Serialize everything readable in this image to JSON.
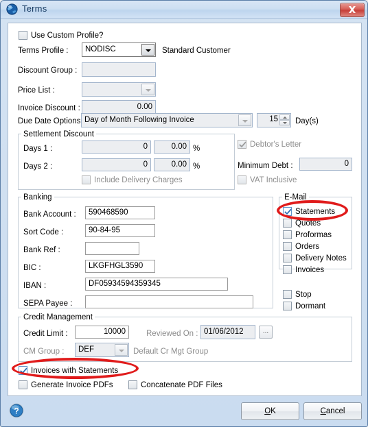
{
  "window": {
    "title": "Terms",
    "app_icon": "globe-icon",
    "close_label": "close-icon"
  },
  "form": {
    "use_custom_profile": {
      "label": "Use Custom Profile?",
      "checked": false
    },
    "terms_profile": {
      "label": "Terms Profile :",
      "value": "NODISC",
      "note": "Standard Customer"
    },
    "discount_group": {
      "label": "Discount Group :",
      "value": ""
    },
    "price_list": {
      "label": "Price List :",
      "value": ""
    },
    "invoice_discount": {
      "label": "Invoice Discount :",
      "value": "0.00"
    },
    "due_date_options": {
      "label": "Due Date Options :",
      "value": "Day of Month Following Invoice"
    },
    "days_spinner": {
      "value": "15",
      "suffix": "Day(s)"
    }
  },
  "settlement_discount": {
    "title": "Settlement Discount",
    "days1": {
      "label": "Days 1 :",
      "days": "0",
      "percent": "0.00",
      "unit": "%"
    },
    "days2": {
      "label": "Days 2 :",
      "days": "0",
      "percent": "0.00",
      "unit": "%"
    },
    "include_delivery_charges": {
      "label": "Include Delivery Charges",
      "checked": false
    }
  },
  "debtor": {
    "letter": {
      "label": "Debtor's Letter",
      "checked": true
    },
    "minimum_debt": {
      "label": "Minimum Debt :",
      "value": "0"
    },
    "vat_inclusive": {
      "label": "VAT Inclusive",
      "checked": false
    }
  },
  "banking": {
    "title": "Banking",
    "bank_account": {
      "label": "Bank Account :",
      "value": "590468590"
    },
    "sort_code": {
      "label": "Sort Code :",
      "value": "90-84-95"
    },
    "bank_ref": {
      "label": "Bank Ref :",
      "value": ""
    },
    "bic": {
      "label": "BIC :",
      "value": "LKGFHGL3590"
    },
    "iban": {
      "label": "IBAN :",
      "value": "DF05934594359345"
    },
    "sepa_payee": {
      "label": "SEPA Payee :",
      "value": ""
    }
  },
  "email": {
    "title": "E-Mail",
    "items": [
      {
        "label": "Statements",
        "checked": true
      },
      {
        "label": "Quotes",
        "checked": false
      },
      {
        "label": "Proformas",
        "checked": false
      },
      {
        "label": "Orders",
        "checked": false
      },
      {
        "label": "Delivery Notes",
        "checked": false
      },
      {
        "label": "Invoices",
        "checked": false
      }
    ]
  },
  "flags": {
    "stop": {
      "label": "Stop",
      "checked": false
    },
    "dormant": {
      "label": "Dormant",
      "checked": false
    }
  },
  "credit_management": {
    "title": "Credit Management",
    "credit_limit": {
      "label": "Credit Limit :",
      "value": "10000"
    },
    "reviewed_on": {
      "label": "Reviewed On :",
      "value": "01/06/2012",
      "browse_label": "..."
    },
    "cm_group": {
      "label": "CM Group :",
      "value": "DEF",
      "note": "Default Cr Mgt Group"
    }
  },
  "pdf_options": {
    "invoices_with_statements": {
      "label": "Invoices with Statements",
      "checked": true
    },
    "generate_invoice_pdfs": {
      "label": "Generate Invoice PDFs",
      "checked": false
    },
    "concatenate_pdf_files": {
      "label": "Concatenate PDF Files",
      "checked": false
    }
  },
  "footer": {
    "help": "help-icon",
    "ok": {
      "mnemonic": "O",
      "rest": "K"
    },
    "cancel": {
      "mnemonic": "C",
      "rest": "ancel"
    }
  },
  "annotations": {
    "color": "#e01b1b",
    "ellipses": [
      {
        "name": "statements-highlight"
      },
      {
        "name": "invoices-with-statements-highlight"
      }
    ]
  }
}
